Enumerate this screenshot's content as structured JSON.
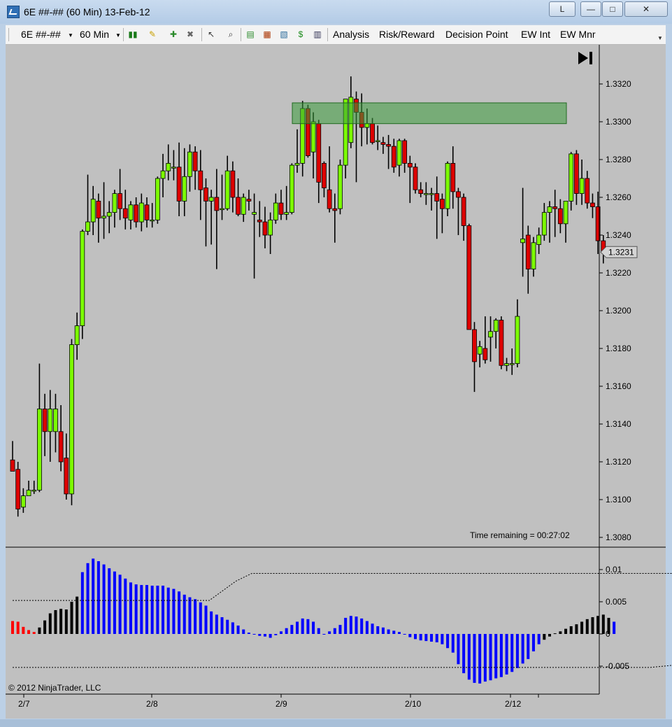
{
  "window": {
    "title": "6E ##-## (60 Min)  13-Feb-12",
    "buttons": {
      "l": "L",
      "minimize": "—",
      "maximize": "□",
      "close": "✕"
    }
  },
  "toolbar": {
    "instrument": "6E ##-##",
    "interval": "60 Min",
    "menus": [
      "Analysis",
      "Risk/Reward",
      "Decision Point",
      "EW Int",
      "EW Mnr"
    ],
    "icons": [
      "bar-type-icon",
      "drawing-pencil-icon",
      "add-indicator-icon",
      "remove-indicator-icon",
      "cursor-icon",
      "zoom-icon",
      "strategies-icon",
      "chart-trader-icon",
      "data-box-icon",
      "dollar-icon",
      "properties-icon"
    ]
  },
  "price_panel": {
    "y_ticks": [
      "1.3320",
      "1.3300",
      "1.3280",
      "1.3260",
      "1.3240",
      "1.3220",
      "1.3200",
      "1.3180",
      "1.3160",
      "1.3140",
      "1.3120",
      "1.3100",
      "1.3080"
    ],
    "last_price": "1.3231",
    "time_remaining": "Time remaining = 00:27:02",
    "go_to_end_icon": "skip-to-end-icon",
    "zone": {
      "price_top": 1.331,
      "price_bottom": 1.3299,
      "color": "#3a9a3a"
    }
  },
  "oscillator_panel": {
    "y_ticks": [
      "0.01",
      "0.005",
      "0",
      "-0.005"
    ],
    "copyright": "© 2012 NinjaTrader, LLC"
  },
  "x_axis": {
    "labels": [
      "2/7",
      "2/8",
      "2/9",
      "2/10",
      "2/12"
    ]
  },
  "colors": {
    "up_candle": "#7cfc00",
    "down_candle": "#dd0000",
    "hist_blue": "#0000ff",
    "hist_black": "#000000",
    "hist_red": "#ff0000",
    "background": "#c0c0c0"
  },
  "chart_data": {
    "type": "candlestick",
    "title": "",
    "y_range": [
      1.3075,
      1.333
    ],
    "x_tick_labels": [
      "2/7",
      "2/8",
      "2/9",
      "2/10",
      "2/12"
    ],
    "last_price": 1.3231,
    "candles": [
      {
        "o": 1.3121,
        "h": 1.3131,
        "l": 1.3115,
        "c": 1.3115
      },
      {
        "o": 1.3116,
        "h": 1.312,
        "l": 1.3091,
        "c": 1.3095
      },
      {
        "o": 1.3096,
        "h": 1.3106,
        "l": 1.3093,
        "c": 1.3102
      },
      {
        "o": 1.3102,
        "h": 1.311,
        "l": 1.3102,
        "c": 1.3105
      },
      {
        "o": 1.3105,
        "h": 1.311,
        "l": 1.3103,
        "c": 1.3105
      },
      {
        "o": 1.3105,
        "h": 1.3172,
        "l": 1.3104,
        "c": 1.3148
      },
      {
        "o": 1.3148,
        "h": 1.3156,
        "l": 1.3123,
        "c": 1.3136
      },
      {
        "o": 1.3136,
        "h": 1.3158,
        "l": 1.312,
        "c": 1.3148
      },
      {
        "o": 1.3136,
        "h": 1.3156,
        "l": 1.3125,
        "c": 1.3148
      },
      {
        "o": 1.3136,
        "h": 1.315,
        "l": 1.3115,
        "c": 1.312
      },
      {
        "o": 1.3122,
        "h": 1.3135,
        "l": 1.31,
        "c": 1.3103
      },
      {
        "o": 1.3103,
        "h": 1.3185,
        "l": 1.3097,
        "c": 1.3182
      },
      {
        "o": 1.3182,
        "h": 1.3199,
        "l": 1.3174,
        "c": 1.3192
      },
      {
        "o": 1.3192,
        "h": 1.3243,
        "l": 1.3185,
        "c": 1.3242
      },
      {
        "o": 1.3242,
        "h": 1.3272,
        "l": 1.324,
        "c": 1.3247
      },
      {
        "o": 1.3247,
        "h": 1.3266,
        "l": 1.324,
        "c": 1.3259
      },
      {
        "o": 1.3258,
        "h": 1.3262,
        "l": 1.3236,
        "c": 1.3249
      },
      {
        "o": 1.3249,
        "h": 1.3268,
        "l": 1.3238,
        "c": 1.325
      },
      {
        "o": 1.325,
        "h": 1.3258,
        "l": 1.3241,
        "c": 1.3252
      },
      {
        "o": 1.3252,
        "h": 1.3264,
        "l": 1.3244,
        "c": 1.3262
      },
      {
        "o": 1.3262,
        "h": 1.3275,
        "l": 1.3248,
        "c": 1.3254
      },
      {
        "o": 1.3254,
        "h": 1.3264,
        "l": 1.3243,
        "c": 1.3249
      },
      {
        "o": 1.3248,
        "h": 1.3258,
        "l": 1.3243,
        "c": 1.3256
      },
      {
        "o": 1.3256,
        "h": 1.326,
        "l": 1.3244,
        "c": 1.3247
      },
      {
        "o": 1.3247,
        "h": 1.3262,
        "l": 1.3242,
        "c": 1.3257
      },
      {
        "o": 1.3256,
        "h": 1.326,
        "l": 1.3244,
        "c": 1.3248
      },
      {
        "o": 1.3248,
        "h": 1.3257,
        "l": 1.3244,
        "c": 1.3248
      },
      {
        "o": 1.3248,
        "h": 1.3271,
        "l": 1.3246,
        "c": 1.327
      },
      {
        "o": 1.327,
        "h": 1.3283,
        "l": 1.326,
        "c": 1.3274
      },
      {
        "o": 1.3274,
        "h": 1.3288,
        "l": 1.3269,
        "c": 1.3278
      },
      {
        "o": 1.3276,
        "h": 1.3285,
        "l": 1.3269,
        "c": 1.3276
      },
      {
        "o": 1.3276,
        "h": 1.3289,
        "l": 1.325,
        "c": 1.3258
      },
      {
        "o": 1.3258,
        "h": 1.3286,
        "l": 1.325,
        "c": 1.3271
      },
      {
        "o": 1.3271,
        "h": 1.3288,
        "l": 1.3263,
        "c": 1.3284
      },
      {
        "o": 1.3284,
        "h": 1.3287,
        "l": 1.3264,
        "c": 1.3274
      },
      {
        "o": 1.3274,
        "h": 1.3285,
        "l": 1.3248,
        "c": 1.3264
      },
      {
        "o": 1.3265,
        "h": 1.327,
        "l": 1.3234,
        "c": 1.3258
      },
      {
        "o": 1.3258,
        "h": 1.3264,
        "l": 1.3235,
        "c": 1.326
      },
      {
        "o": 1.326,
        "h": 1.3275,
        "l": 1.3222,
        "c": 1.3253
      },
      {
        "o": 1.3254,
        "h": 1.3272,
        "l": 1.3248,
        "c": 1.3254
      },
      {
        "o": 1.3254,
        "h": 1.3282,
        "l": 1.3253,
        "c": 1.3274
      },
      {
        "o": 1.3274,
        "h": 1.3279,
        "l": 1.3252,
        "c": 1.326
      },
      {
        "o": 1.326,
        "h": 1.327,
        "l": 1.325,
        "c": 1.3251
      },
      {
        "o": 1.3251,
        "h": 1.3262,
        "l": 1.3247,
        "c": 1.326
      },
      {
        "o": 1.3259,
        "h": 1.3264,
        "l": 1.3253,
        "c": 1.3258
      },
      {
        "o": 1.3251,
        "h": 1.3262,
        "l": 1.3217,
        "c": 1.3252
      },
      {
        "o": 1.3248,
        "h": 1.3258,
        "l": 1.3239,
        "c": 1.3247
      },
      {
        "o": 1.3247,
        "h": 1.3255,
        "l": 1.3233,
        "c": 1.324
      },
      {
        "o": 1.324,
        "h": 1.3252,
        "l": 1.323,
        "c": 1.3248
      },
      {
        "o": 1.3248,
        "h": 1.3262,
        "l": 1.3246,
        "c": 1.3257
      },
      {
        "o": 1.3257,
        "h": 1.3264,
        "l": 1.3248,
        "c": 1.3251
      },
      {
        "o": 1.3251,
        "h": 1.3266,
        "l": 1.3248,
        "c": 1.3252
      },
      {
        "o": 1.3252,
        "h": 1.3278,
        "l": 1.3251,
        "c": 1.3277
      },
      {
        "o": 1.3277,
        "h": 1.3296,
        "l": 1.3273,
        "c": 1.3278
      },
      {
        "o": 1.3278,
        "h": 1.3311,
        "l": 1.3271,
        "c": 1.3307
      },
      {
        "o": 1.3307,
        "h": 1.3309,
        "l": 1.3281,
        "c": 1.3282
      },
      {
        "o": 1.3284,
        "h": 1.3305,
        "l": 1.327,
        "c": 1.33
      },
      {
        "o": 1.3299,
        "h": 1.3301,
        "l": 1.3257,
        "c": 1.3268
      },
      {
        "o": 1.3278,
        "h": 1.3279,
        "l": 1.326,
        "c": 1.3265
      },
      {
        "o": 1.3264,
        "h": 1.3287,
        "l": 1.3252,
        "c": 1.3254
      },
      {
        "o": 1.3254,
        "h": 1.3262,
        "l": 1.3236,
        "c": 1.3253
      },
      {
        "o": 1.3254,
        "h": 1.328,
        "l": 1.3251,
        "c": 1.3277
      },
      {
        "o": 1.3277,
        "h": 1.3307,
        "l": 1.327,
        "c": 1.3312
      },
      {
        "o": 1.3289,
        "h": 1.3324,
        "l": 1.3286,
        "c": 1.3313
      },
      {
        "o": 1.3312,
        "h": 1.3316,
        "l": 1.3268,
        "c": 1.3305
      },
      {
        "o": 1.3305,
        "h": 1.3315,
        "l": 1.3287,
        "c": 1.3297
      },
      {
        "o": 1.3297,
        "h": 1.3307,
        "l": 1.3288,
        "c": 1.3299
      },
      {
        "o": 1.3299,
        "h": 1.3302,
        "l": 1.3288,
        "c": 1.3289
      },
      {
        "o": 1.329,
        "h": 1.3298,
        "l": 1.3285,
        "c": 1.329
      },
      {
        "o": 1.3289,
        "h": 1.3292,
        "l": 1.3283,
        "c": 1.3288
      },
      {
        "o": 1.3288,
        "h": 1.3293,
        "l": 1.3275,
        "c": 1.3287
      },
      {
        "o": 1.3287,
        "h": 1.3291,
        "l": 1.3273,
        "c": 1.3276
      },
      {
        "o": 1.3277,
        "h": 1.3291,
        "l": 1.3271,
        "c": 1.329
      },
      {
        "o": 1.329,
        "h": 1.3291,
        "l": 1.3273,
        "c": 1.3278
      },
      {
        "o": 1.3278,
        "h": 1.3282,
        "l": 1.3257,
        "c": 1.3276
      },
      {
        "o": 1.3276,
        "h": 1.3278,
        "l": 1.3262,
        "c": 1.3264
      },
      {
        "o": 1.3264,
        "h": 1.3268,
        "l": 1.326,
        "c": 1.3262
      },
      {
        "o": 1.3262,
        "h": 1.3268,
        "l": 1.3256,
        "c": 1.3262
      },
      {
        "o": 1.3262,
        "h": 1.3265,
        "l": 1.3253,
        "c": 1.3262
      },
      {
        "o": 1.3262,
        "h": 1.3271,
        "l": 1.3238,
        "c": 1.3258
      },
      {
        "o": 1.3259,
        "h": 1.3262,
        "l": 1.3241,
        "c": 1.3254
      },
      {
        "o": 1.3254,
        "h": 1.3279,
        "l": 1.325,
        "c": 1.3278
      },
      {
        "o": 1.3278,
        "h": 1.3287,
        "l": 1.3254,
        "c": 1.3263
      },
      {
        "o": 1.3263,
        "h": 1.3265,
        "l": 1.324,
        "c": 1.326
      },
      {
        "o": 1.326,
        "h": 1.3262,
        "l": 1.3237,
        "c": 1.3245
      },
      {
        "o": 1.3245,
        "h": 1.3246,
        "l": 1.319,
        "c": 1.319
      },
      {
        "o": 1.319,
        "h": 1.3194,
        "l": 1.3157,
        "c": 1.3173
      },
      {
        "o": 1.3177,
        "h": 1.3184,
        "l": 1.317,
        "c": 1.3181
      },
      {
        "o": 1.318,
        "h": 1.3197,
        "l": 1.3172,
        "c": 1.3174
      },
      {
        "o": 1.3186,
        "h": 1.3197,
        "l": 1.3173,
        "c": 1.3189
      },
      {
        "o": 1.3189,
        "h": 1.3196,
        "l": 1.318,
        "c": 1.3195
      },
      {
        "o": 1.3195,
        "h": 1.3197,
        "l": 1.3169,
        "c": 1.3171
      },
      {
        "o": 1.3171,
        "h": 1.3175,
        "l": 1.3168,
        "c": 1.3172
      },
      {
        "o": 1.3172,
        "h": 1.318,
        "l": 1.3166,
        "c": 1.3172
      },
      {
        "o": 1.3172,
        "h": 1.3206,
        "l": 1.317,
        "c": 1.3197
      },
      {
        "o": 1.3236,
        "h": 1.3265,
        "l": 1.3218,
        "c": 1.3238
      },
      {
        "o": 1.324,
        "h": 1.3245,
        "l": 1.3209,
        "c": 1.3222
      },
      {
        "o": 1.3222,
        "h": 1.3239,
        "l": 1.3218,
        "c": 1.3236
      },
      {
        "o": 1.3235,
        "h": 1.3244,
        "l": 1.323,
        "c": 1.324
      },
      {
        "o": 1.324,
        "h": 1.3257,
        "l": 1.3237,
        "c": 1.3252
      },
      {
        "o": 1.3252,
        "h": 1.3258,
        "l": 1.3236,
        "c": 1.3255
      },
      {
        "o": 1.3255,
        "h": 1.3264,
        "l": 1.3239,
        "c": 1.3254
      },
      {
        "o": 1.3254,
        "h": 1.3259,
        "l": 1.3241,
        "c": 1.3246
      },
      {
        "o": 1.3246,
        "h": 1.3258,
        "l": 1.3236,
        "c": 1.3258
      },
      {
        "o": 1.3258,
        "h": 1.3284,
        "l": 1.3253,
        "c": 1.3283
      },
      {
        "o": 1.3283,
        "h": 1.3285,
        "l": 1.3256,
        "c": 1.3262
      },
      {
        "o": 1.3262,
        "h": 1.328,
        "l": 1.3256,
        "c": 1.327
      },
      {
        "o": 1.327,
        "h": 1.3274,
        "l": 1.3254,
        "c": 1.3257
      },
      {
        "o": 1.3257,
        "h": 1.3262,
        "l": 1.3249,
        "c": 1.3255
      },
      {
        "o": 1.3255,
        "h": 1.3263,
        "l": 1.323,
        "c": 1.3237
      },
      {
        "o": 1.3237,
        "h": 1.324,
        "l": 1.3225,
        "c": 1.3231
      }
    ],
    "oscillator": {
      "y_range": [
        -0.0083,
        0.0127
      ],
      "histogram": [
        0.002,
        0.0019,
        0.0011,
        0.0006,
        0.0003,
        0.001,
        0.0021,
        0.0032,
        0.0037,
        0.0039,
        0.0038,
        0.005,
        0.0058,
        0.0096,
        0.011,
        0.0117,
        0.0113,
        0.0108,
        0.0102,
        0.0097,
        0.0092,
        0.0086,
        0.008,
        0.0077,
        0.0076,
        0.0076,
        0.0075,
        0.0075,
        0.0075,
        0.0072,
        0.007,
        0.0066,
        0.0061,
        0.0057,
        0.0054,
        0.0049,
        0.0044,
        0.0035,
        0.003,
        0.0026,
        0.0022,
        0.0018,
        0.0013,
        0.0007,
        0.0002,
        -0.0001,
        -0.0003,
        -0.0004,
        -0.0006,
        -0.0002,
        0.0004,
        0.0009,
        0.0014,
        0.0019,
        0.0024,
        0.0023,
        0.0019,
        0.0009,
        0.0,
        0.0004,
        0.0009,
        0.0014,
        0.0025,
        0.0028,
        0.0027,
        0.0024,
        0.002,
        0.0016,
        0.0012,
        0.001,
        0.0007,
        0.0005,
        0.0003,
        -0.0001,
        -0.0005,
        -0.0008,
        -0.001,
        -0.0011,
        -0.0012,
        -0.0013,
        -0.0016,
        -0.0022,
        -0.0029,
        -0.0047,
        -0.0061,
        -0.0071,
        -0.0076,
        -0.0077,
        -0.0074,
        -0.0072,
        -0.0069,
        -0.0067,
        -0.0063,
        -0.0059,
        -0.0053,
        -0.0046,
        -0.0039,
        -0.0027,
        -0.0016,
        -0.0009,
        -0.0004,
        0.0001,
        0.0004,
        0.0008,
        0.0012,
        0.0015,
        0.0019,
        0.0023,
        0.0026,
        0.0028,
        0.003,
        0.0025,
        0.0019
      ],
      "hist_colors": [
        "red",
        "red",
        "red",
        "red",
        "red",
        "black",
        "black",
        "black",
        "black",
        "black",
        "black",
        "black",
        "black",
        "blue",
        "blue",
        "blue",
        "blue",
        "blue",
        "blue",
        "blue",
        "blue",
        "blue",
        "blue",
        "blue",
        "blue",
        "blue",
        "blue",
        "blue",
        "blue",
        "blue",
        "blue",
        "blue",
        "blue",
        "blue",
        "blue",
        "blue",
        "blue",
        "blue",
        "blue",
        "blue",
        "blue",
        "blue",
        "blue",
        "blue",
        "blue",
        "blue",
        "blue",
        "blue",
        "blue",
        "blue",
        "blue",
        "blue",
        "blue",
        "blue",
        "blue",
        "blue",
        "blue",
        "blue",
        "blue",
        "blue",
        "blue",
        "blue",
        "blue",
        "blue",
        "blue",
        "blue",
        "blue",
        "blue",
        "blue",
        "blue",
        "blue",
        "blue",
        "blue",
        "blue",
        "blue",
        "blue",
        "blue",
        "blue",
        "blue",
        "blue",
        "blue",
        "blue",
        "blue",
        "blue",
        "blue",
        "blue",
        "blue",
        "blue",
        "blue",
        "blue",
        "blue",
        "blue",
        "blue",
        "blue",
        "blue",
        "blue",
        "blue",
        "blue",
        "blue",
        "black",
        "black",
        "black",
        "black",
        "black",
        "black",
        "black",
        "black",
        "black",
        "black",
        "black",
        "black",
        "black"
      ],
      "upper_band": [
        [
          0,
          0.0052
        ],
        [
          18,
          0.0052
        ],
        [
          37,
          0.0052
        ],
        [
          42,
          0.0082
        ],
        [
          45,
          0.0094
        ],
        [
          58,
          0.0094
        ],
        [
          140,
          0.0094
        ]
      ],
      "lower_band": [
        [
          0,
          -0.0052
        ],
        [
          120,
          -0.0052
        ],
        [
          125,
          -0.0048
        ],
        [
          130,
          -0.0062
        ],
        [
          140,
          -0.0062
        ]
      ]
    }
  }
}
